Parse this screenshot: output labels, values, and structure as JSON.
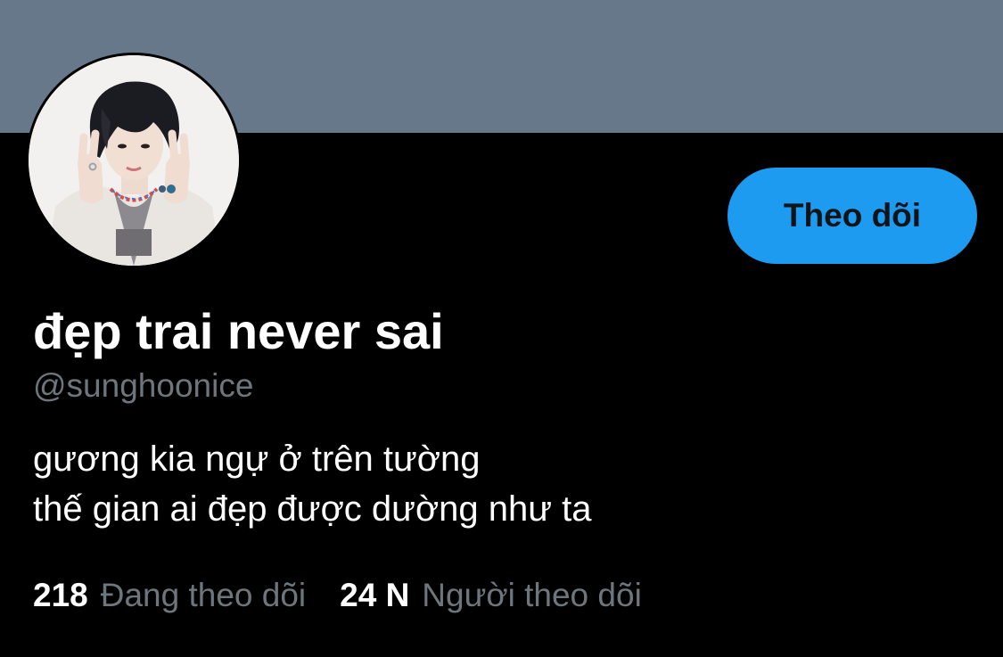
{
  "profile": {
    "display_name": "đẹp trai never sai",
    "handle": "@sunghoonice",
    "bio_lines": [
      "gương kia ngự ở trên tường",
      "thế gian ai đẹp được dường như ta"
    ],
    "follow_button_label": "Theo dõi"
  },
  "stats": {
    "following_count": "218",
    "following_label": "Đang theo dõi",
    "followers_count": "24 N",
    "followers_label": "Người theo dõi"
  },
  "colors": {
    "banner": "#66788a",
    "background": "#000000",
    "accent": "#1d9bf0",
    "secondary_text": "#6e767d",
    "primary_text": "#ffffff"
  },
  "icons": {
    "avatar": "profile-photo"
  }
}
